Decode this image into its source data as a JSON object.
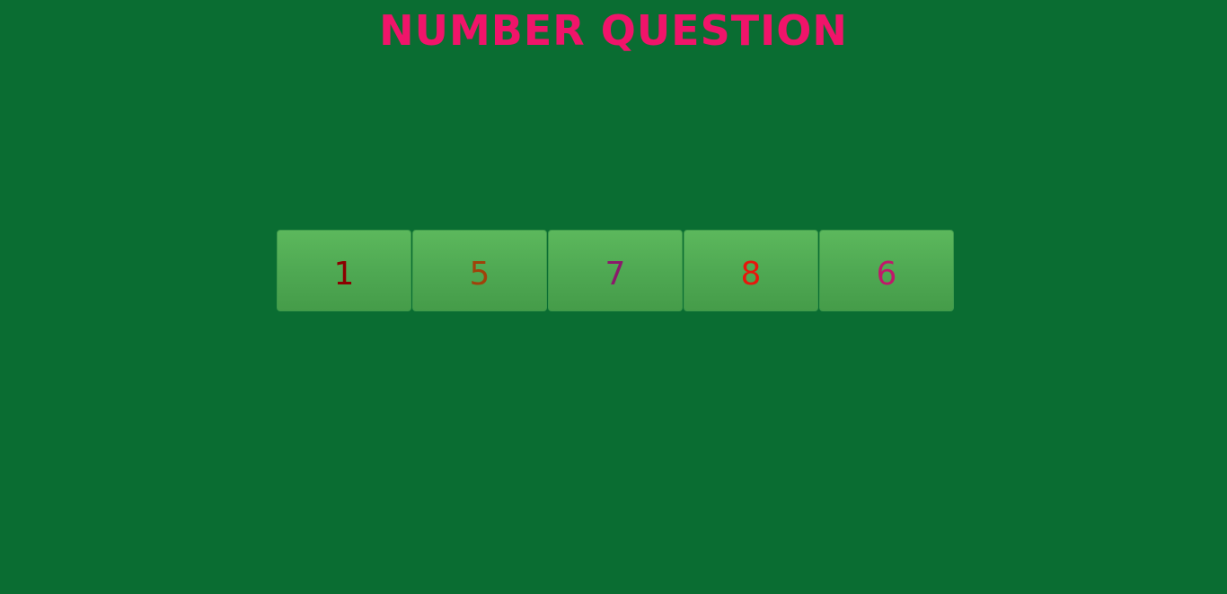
{
  "title": {
    "text": "NUMBER QUESTION",
    "color": "#f0146a"
  },
  "background_color": "#0a6d32",
  "tiles": [
    {
      "label": "1",
      "color": "#8b0000"
    },
    {
      "label": "5",
      "color": "#a0420a"
    },
    {
      "label": "7",
      "color": "#8b1a6b"
    },
    {
      "label": "8",
      "color": "#e8160c"
    },
    {
      "label": "6",
      "color": "#c0186a"
    }
  ]
}
